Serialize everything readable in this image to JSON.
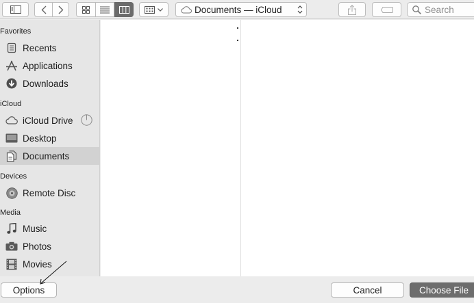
{
  "toolbar": {
    "path_label": "Documents — iCloud",
    "search_placeholder": "Search"
  },
  "sidebar": {
    "favorites_heading": "Favorites",
    "favorites": [
      {
        "label": "Recents",
        "icon": "recents-icon"
      },
      {
        "label": "Applications",
        "icon": "applications-icon"
      },
      {
        "label": "Downloads",
        "icon": "downloads-icon"
      }
    ],
    "icloud_heading": "iCloud",
    "icloud": [
      {
        "label": "iCloud Drive",
        "icon": "cloud-icon"
      },
      {
        "label": "Desktop",
        "icon": "desktop-icon"
      },
      {
        "label": "Documents",
        "icon": "documents-icon",
        "selected": true
      }
    ],
    "devices_heading": "Devices",
    "devices": [
      {
        "label": "Remote Disc",
        "icon": "disc-icon"
      }
    ],
    "media_heading": "Media",
    "media": [
      {
        "label": "Music",
        "icon": "music-note-icon"
      },
      {
        "label": "Photos",
        "icon": "camera-icon"
      },
      {
        "label": "Movies",
        "icon": "film-icon"
      }
    ]
  },
  "bottom": {
    "options_label": "Options",
    "cancel_label": "Cancel",
    "choose_label": "Choose File"
  },
  "colors": {
    "window_bg": "#ececec",
    "sidebar_bg": "#e6e6e6",
    "selected_bg": "#d2d2d2",
    "primary_button": "#6d6d6d"
  }
}
